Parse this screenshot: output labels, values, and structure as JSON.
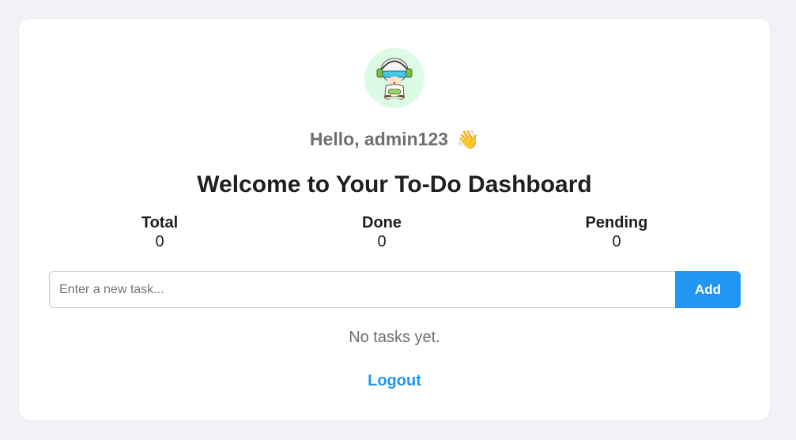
{
  "greeting": {
    "text": "Hello, admin123",
    "emoji": "👋"
  },
  "title": "Welcome to Your To-Do Dashboard",
  "stats": {
    "total": {
      "label": "Total",
      "value": "0"
    },
    "done": {
      "label": "Done",
      "value": "0"
    },
    "pending": {
      "label": "Pending",
      "value": "0"
    }
  },
  "task_input": {
    "placeholder": "Enter a new task...",
    "value": ""
  },
  "add_button": {
    "label": "Add"
  },
  "empty_state": "No tasks yet.",
  "logout": {
    "label": "Logout"
  },
  "colors": {
    "accent": "#2196f3",
    "avatar_bg": "#dcfbe4",
    "page_bg": "#f1f2f6"
  },
  "avatar": {
    "icon": "gamer-character-avatar"
  }
}
